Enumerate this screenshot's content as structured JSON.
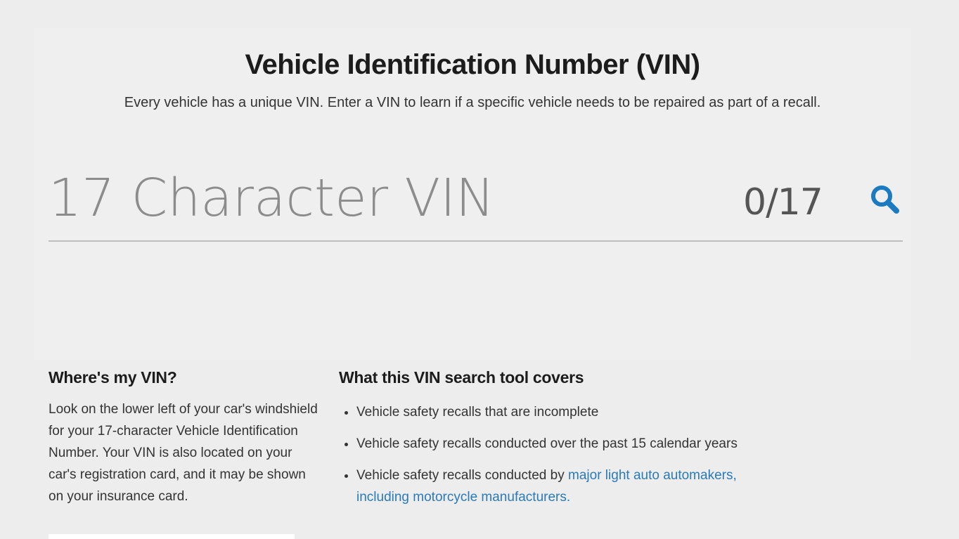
{
  "hero": {
    "title": "Vehicle Identification Number (VIN)",
    "subtitle": "Every vehicle has a unique VIN. Enter a VIN to learn if a specific vehicle needs to be repaired as part of a recall."
  },
  "vin_search": {
    "placeholder": "17 Character VIN",
    "value": "",
    "counter": "0/17",
    "search_icon": "search-icon",
    "accent_color": "#1b7ac0"
  },
  "where": {
    "heading": "Where's my VIN?",
    "body": "Look on the lower left of your car's windshield for your 17-character Vehicle Identification Number. Your VIN is also located on your car's registration card, and it may be shown on your insurance card."
  },
  "coverage": {
    "heading": "What this VIN search tool covers",
    "items": [
      "Vehicle safety recalls that are incomplete",
      "Vehicle safety recalls conducted over the past 15 calendar years"
    ],
    "item3_prefix": "Vehicle safety recalls conducted by ",
    "item3_link": "major light auto automakers, including motorcycle manufacturers.",
    "link_color": "#2b7ab8"
  }
}
